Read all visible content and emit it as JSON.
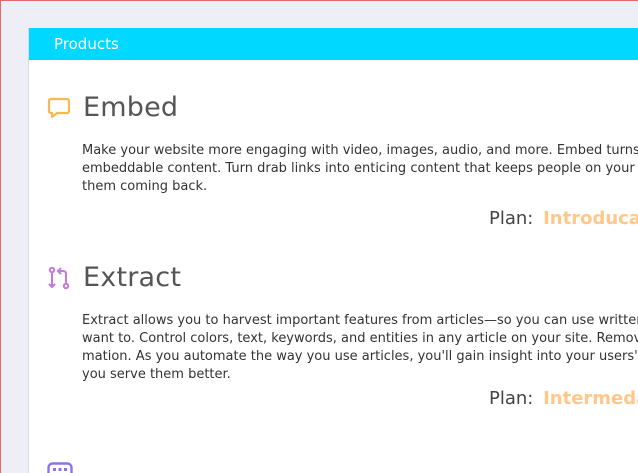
{
  "header": {
    "title": "Products"
  },
  "products": [
    {
      "title": "Embed",
      "icon": "chat-bubble-icon",
      "icon_color": "#f7b955",
      "description": "Make your website more engaging with video, images, audio, and more. Embed turns embeddable content. Turn drab links into enticing content that keeps people on your s them coming back.",
      "plan_label": "Plan:",
      "plan_value": "Introducat"
    },
    {
      "title": "Extract",
      "icon": "merge-arrows-icon",
      "icon_color": "#c57ae0",
      "description": "Extract allows you to harvest important features from articles—so you can use written c want to. Control colors, text, keywords, and entities in any article on your site. Remove mation. As you automate the way you use articles, you'll gain insight into your users' pr ing you serve them better.",
      "plan_label": "Plan:",
      "plan_value": "Intermedat"
    }
  ],
  "next_product": {
    "icon": "grid-keyboard-icon",
    "icon_color": "#8c74e6"
  },
  "colors": {
    "header_bg": "#00d8ff",
    "plan_value": "#ffc88a",
    "page_bg": "#eeeef6"
  }
}
